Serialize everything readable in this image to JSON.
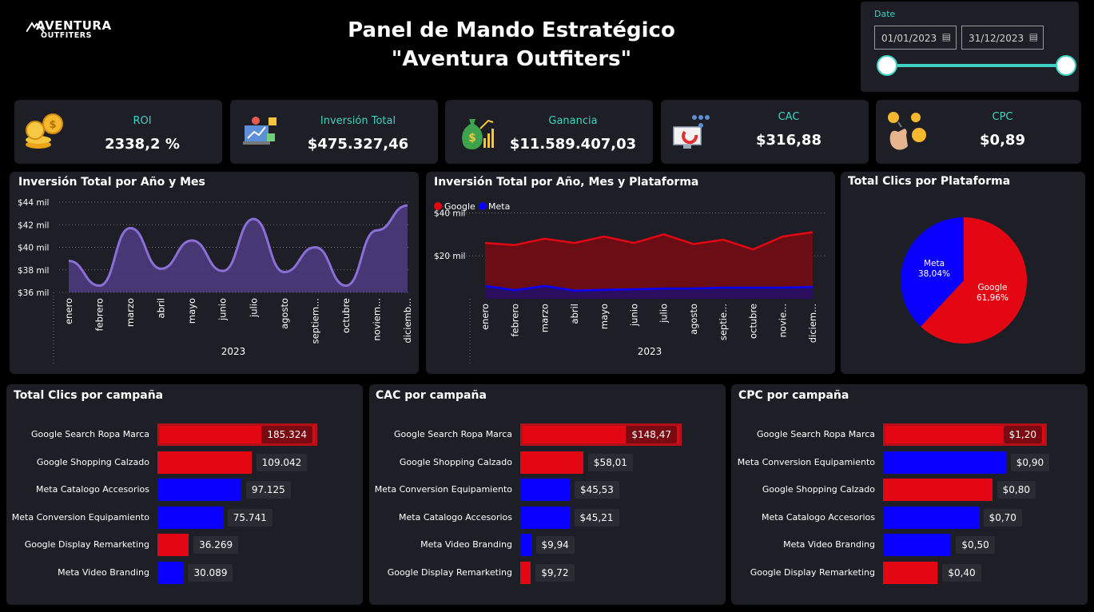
{
  "logo": {
    "main": "AVENTURA",
    "sub": "OUTFITERS"
  },
  "title": {
    "line1": "Panel de Mando Estratégico",
    "line2": "\"Aventura Outfiters\""
  },
  "date_filter": {
    "label": "Date",
    "start": "01/01/2023",
    "end": "31/12/2023"
  },
  "colors": {
    "accent": "#3fd1c1",
    "google": "#e30613",
    "meta": "#0a00ff",
    "purple": "#8b6fd6",
    "panel": "#1e1f26"
  },
  "kpis": [
    {
      "label": "ROI",
      "value": "2338,2 %",
      "icon": "coins-icon"
    },
    {
      "label": "Inversión Total",
      "value": "$475.327,46",
      "icon": "investment-icon"
    },
    {
      "label": "Ganancia",
      "value": "$11.589.407,03",
      "icon": "money-bag-growth-icon"
    },
    {
      "label": "CAC",
      "value": "$316,88",
      "icon": "customer-magnet-icon"
    },
    {
      "label": "CPC",
      "value": "$0,89",
      "icon": "click-coins-icon"
    }
  ],
  "chart_invest_month": {
    "title": "Inversión Total por Año y Mes",
    "year_label": "2023"
  },
  "chart_invest_platform": {
    "title": "Inversión Total por Año, Mes y Plataforma",
    "legend": [
      "Google",
      "Meta"
    ],
    "year_label": "2023"
  },
  "chart_clicks_platform": {
    "title": "Total Clics por Plataforma",
    "slices": [
      {
        "name": "Google",
        "pct_label": "61,96%"
      },
      {
        "name": "Meta",
        "pct_label": "38,04%"
      }
    ]
  },
  "bars_clicks": {
    "title": "Total Clics por campaña",
    "rows": [
      {
        "label": "Google Search Ropa Marca",
        "value_label": "185.324",
        "value": 185324,
        "platform": "google"
      },
      {
        "label": "Google Shopping Calzado",
        "value_label": "109.042",
        "value": 109042,
        "platform": "google"
      },
      {
        "label": "Meta Catalogo Accesorios",
        "value_label": "97.125",
        "value": 97125,
        "platform": "meta"
      },
      {
        "label": "Meta Conversion Equipamiento",
        "value_label": "75.741",
        "value": 75741,
        "platform": "meta"
      },
      {
        "label": "Google Display Remarketing",
        "value_label": "36.269",
        "value": 36269,
        "platform": "google"
      },
      {
        "label": "Meta Video Branding",
        "value_label": "30.089",
        "value": 30089,
        "platform": "meta"
      }
    ]
  },
  "bars_cac": {
    "title": "CAC por campaña",
    "rows": [
      {
        "label": "Google Search Ropa Marca",
        "value_label": "$148,47",
        "value": 148.47,
        "platform": "google"
      },
      {
        "label": "Google Shopping Calzado",
        "value_label": "$58,01",
        "value": 58.01,
        "platform": "google"
      },
      {
        "label": "Meta Conversion Equipamiento",
        "value_label": "$45,53",
        "value": 45.53,
        "platform": "meta"
      },
      {
        "label": "Meta Catalogo Accesorios",
        "value_label": "$45,21",
        "value": 45.21,
        "platform": "meta"
      },
      {
        "label": "Meta Video Branding",
        "value_label": "$9,94",
        "value": 9.94,
        "platform": "meta"
      },
      {
        "label": "Google Display Remarketing",
        "value_label": "$9,72",
        "value": 9.72,
        "platform": "google"
      }
    ]
  },
  "bars_cpc": {
    "title": "CPC por campaña",
    "rows": [
      {
        "label": "Google Search Ropa Marca",
        "value_label": "$1,20",
        "value": 1.2,
        "platform": "google"
      },
      {
        "label": "Meta Conversion Equipamiento",
        "value_label": "$0,90",
        "value": 0.9,
        "platform": "meta"
      },
      {
        "label": "Google Shopping Calzado",
        "value_label": "$0,80",
        "value": 0.8,
        "platform": "google"
      },
      {
        "label": "Meta Catalogo Accesorios",
        "value_label": "$0,70",
        "value": 0.7,
        "platform": "meta"
      },
      {
        "label": "Meta Video Branding",
        "value_label": "$0,50",
        "value": 0.5,
        "platform": "meta"
      },
      {
        "label": "Google Display Remarketing",
        "value_label": "$0,40",
        "value": 0.4,
        "platform": "google"
      }
    ]
  },
  "chart_data": [
    {
      "type": "area",
      "title": "Inversión Total por Año y Mes",
      "xlabel": "2023",
      "x": [
        "enero",
        "febrero",
        "marzo",
        "abril",
        "mayo",
        "junio",
        "julio",
        "agosto",
        "septiem...",
        "octubre",
        "noviem...",
        "diciemb..."
      ],
      "yticks": [
        "$36 mil",
        "$38 mil",
        "$40 mil",
        "$42 mil",
        "$44 mil"
      ],
      "ylim": [
        36000,
        44000
      ],
      "grid": true,
      "series": [
        {
          "values": [
            38800,
            36600,
            41700,
            38100,
            40600,
            37900,
            42500,
            37800,
            40000,
            36600,
            41500,
            43700
          ]
        }
      ]
    },
    {
      "type": "area",
      "title": "Inversión Total por Año, Mes y Plataforma",
      "xlabel": "2023",
      "x": [
        "enero",
        "febrero",
        "marzo",
        "abril",
        "mayo",
        "junio",
        "julio",
        "agosto",
        "septie...",
        "octubre",
        "novie...",
        "diciem..."
      ],
      "yticks": [
        "$20 mil",
        "$40 mil"
      ],
      "ylim": [
        0,
        45000
      ],
      "grid": true,
      "legend": "top-left",
      "series": [
        {
          "name": "Google",
          "values": [
            26000,
            25000,
            28000,
            26000,
            29000,
            26000,
            30000,
            25500,
            27500,
            23000,
            29000,
            31000
          ]
        },
        {
          "name": "Meta",
          "values": [
            6000,
            4000,
            6000,
            3800,
            4200,
            4400,
            4800,
            4800,
            5200,
            5200,
            5200,
            5500
          ]
        }
      ]
    },
    {
      "type": "pie",
      "title": "Total Clics por Plataforma",
      "categories": [
        "Google",
        "Meta"
      ],
      "values": [
        61.96,
        38.04
      ]
    }
  ]
}
